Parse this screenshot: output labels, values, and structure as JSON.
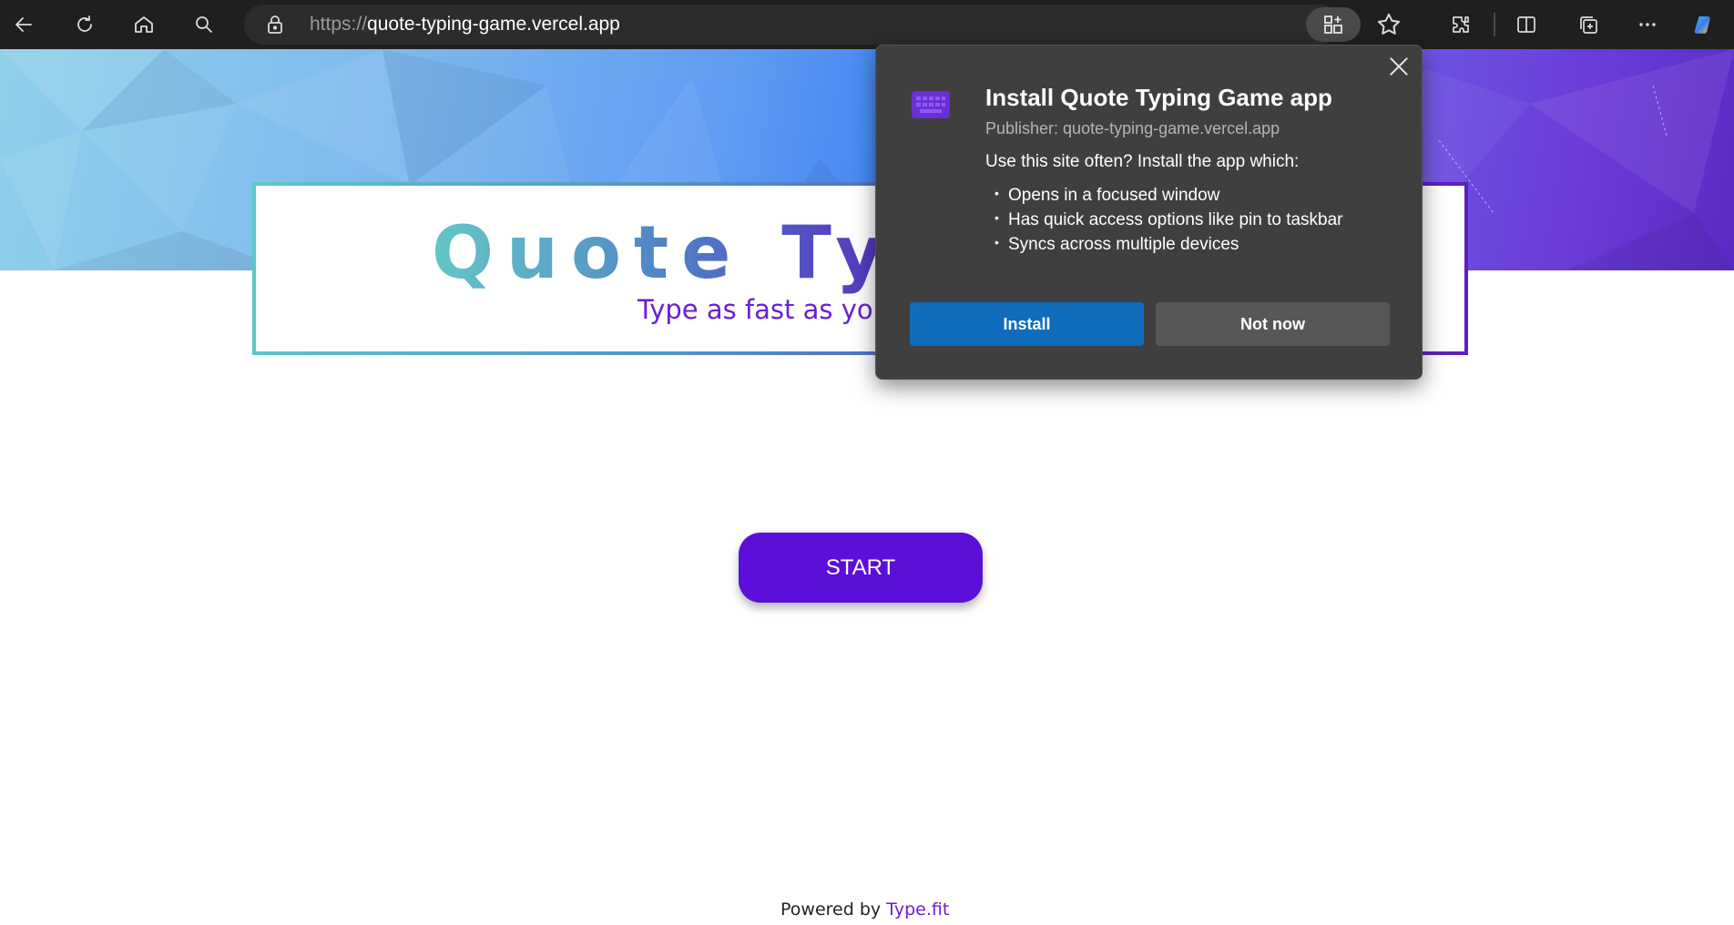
{
  "browser": {
    "url_scheme": "https://",
    "url_host": "quote-typing-game.vercel.app",
    "icons": [
      "back-icon",
      "refresh-icon",
      "home-icon",
      "search-icon",
      "lock-icon",
      "app-available-icon",
      "favorite-star-icon",
      "extensions-icon",
      "split-screen-icon",
      "collections-icon",
      "more-icon",
      "copilot-icon"
    ]
  },
  "page": {
    "title": "Quote Typ",
    "subtitle": "Type as fast as you c",
    "start_label": "START",
    "powered_prefix": "Powered by ",
    "powered_link": "Type.fit"
  },
  "install_popup": {
    "title": "Install Quote Typing Game app",
    "publisher": "Publisher: quote-typing-game.vercel.app",
    "intro": "Use this site often? Install the app which:",
    "benefits": [
      "Opens in a focused window",
      "Has quick access options like pin to taskbar",
      "Syncs across multiple devices"
    ],
    "install_label": "Install",
    "not_now_label": "Not now"
  },
  "colors": {
    "toolbar_bg": "#1f1f1f",
    "accent_purple": "#5b0fd9",
    "subtitle_purple": "#6a1fd1",
    "popup_bg": "#3f3f3f",
    "install_blue": "#0f6cbd"
  }
}
